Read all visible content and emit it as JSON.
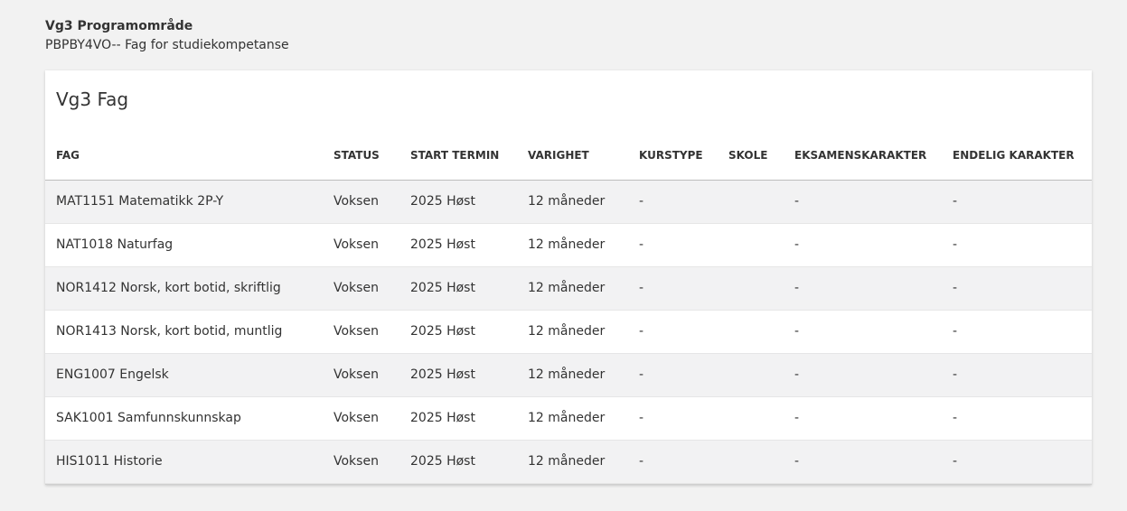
{
  "program": {
    "title": "Vg3 Programområde",
    "code_line": "PBPBY4VO-- Fag for studiekompetanse"
  },
  "card": {
    "title": "Vg3 Fag"
  },
  "table": {
    "headers": {
      "fag": "FAG",
      "status": "STATUS",
      "start_termin": "START TERMIN",
      "varighet": "VARIGHET",
      "kurstype": "KURSTYPE",
      "skole": "SKOLE",
      "eksamenskarakter": "EKSAMENSKARAKTER",
      "endelig_karakter": "ENDELIG KARAKTER"
    },
    "rows": [
      {
        "fag": "MAT1151 Matematikk 2P-Y",
        "status": "Voksen",
        "start_termin": "2025 Høst",
        "varighet": "12 måneder",
        "kurstype": "-",
        "skole": "",
        "eksamenskarakter": "-",
        "endelig_karakter": "-"
      },
      {
        "fag": "NAT1018 Naturfag",
        "status": "Voksen",
        "start_termin": "2025 Høst",
        "varighet": "12 måneder",
        "kurstype": "-",
        "skole": "",
        "eksamenskarakter": "-",
        "endelig_karakter": "-"
      },
      {
        "fag": "NOR1412 Norsk, kort botid, skriftlig",
        "status": "Voksen",
        "start_termin": "2025 Høst",
        "varighet": "12 måneder",
        "kurstype": "-",
        "skole": "",
        "eksamenskarakter": "-",
        "endelig_karakter": "-"
      },
      {
        "fag": "NOR1413 Norsk, kort botid, muntlig",
        "status": "Voksen",
        "start_termin": "2025 Høst",
        "varighet": "12 måneder",
        "kurstype": "-",
        "skole": "",
        "eksamenskarakter": "-",
        "endelig_karakter": "-"
      },
      {
        "fag": "ENG1007 Engelsk",
        "status": "Voksen",
        "start_termin": "2025 Høst",
        "varighet": "12 måneder",
        "kurstype": "-",
        "skole": "",
        "eksamenskarakter": "-",
        "endelig_karakter": "-"
      },
      {
        "fag": "SAK1001 Samfunnskunnskap",
        "status": "Voksen",
        "start_termin": "2025 Høst",
        "varighet": "12 måneder",
        "kurstype": "-",
        "skole": "",
        "eksamenskarakter": "-",
        "endelig_karakter": "-"
      },
      {
        "fag": "HIS1011 Historie",
        "status": "Voksen",
        "start_termin": "2025 Høst",
        "varighet": "12 måneder",
        "kurstype": "-",
        "skole": "",
        "eksamenskarakter": "-",
        "endelig_karakter": "-"
      }
    ]
  }
}
